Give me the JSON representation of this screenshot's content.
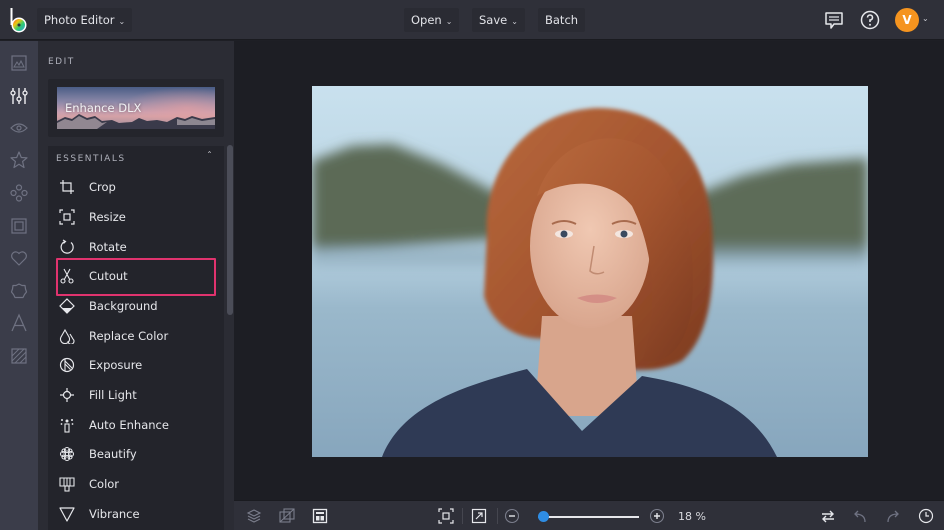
{
  "topbar": {
    "app_menu_label": "Photo Editor",
    "open_label": "Open",
    "save_label": "Save",
    "batch_label": "Batch",
    "icons": [
      "comment-icon",
      "help-icon"
    ],
    "avatar_initial": "V",
    "avatar_color": "#f5941f"
  },
  "rail": {
    "items": [
      {
        "icon": "image-icon",
        "active": false
      },
      {
        "icon": "sliders-icon",
        "active": true
      },
      {
        "icon": "eye-icon",
        "active": false
      },
      {
        "icon": "star-icon",
        "active": false
      },
      {
        "icon": "graphics-icon",
        "active": false
      },
      {
        "icon": "frame-icon",
        "active": false
      },
      {
        "icon": "heart-icon",
        "active": false
      },
      {
        "icon": "badge-icon",
        "active": false
      },
      {
        "icon": "text-icon",
        "active": false
      },
      {
        "icon": "texture-icon",
        "active": false
      }
    ]
  },
  "panel": {
    "section_label": "EDIT",
    "enhance_card_label": "Enhance DLX",
    "essentials": {
      "header": "ESSENTIALS",
      "collapse_glyph": "^",
      "tools": [
        {
          "label": "Crop",
          "icon": "crop-icon"
        },
        {
          "label": "Resize",
          "icon": "resize-icon"
        },
        {
          "label": "Rotate",
          "icon": "rotate-icon"
        },
        {
          "label": "Cutout",
          "icon": "scissors-icon",
          "highlighted": true
        },
        {
          "label": "Background",
          "icon": "background-icon"
        },
        {
          "label": "Replace Color",
          "icon": "droplets-icon"
        },
        {
          "label": "Exposure",
          "icon": "exposure-icon"
        },
        {
          "label": "Fill Light",
          "icon": "fill-light-icon"
        },
        {
          "label": "Auto Enhance",
          "icon": "auto-enhance-icon"
        },
        {
          "label": "Beautify",
          "icon": "beautify-icon"
        },
        {
          "label": "Color",
          "icon": "color-icon"
        },
        {
          "label": "Vibrance",
          "icon": "vibrance-icon"
        }
      ]
    },
    "highlight_color": "#e0336e"
  },
  "canvas": {
    "photo_description": "Portrait of red-haired woman in navy top with blurred lake and hills behind"
  },
  "bottombar": {
    "left_icons": [
      "layers-icon",
      "compare-icon",
      "layout-icon"
    ],
    "fit_icon": "fit-screen-icon",
    "expand_icon": "expand-icon",
    "zoom_out_icon": "zoom-out-icon",
    "zoom_in_icon": "zoom-in-icon",
    "zoom_percent": 18,
    "zoom_label": "18 %",
    "zoom_slider_fraction": 0.05,
    "accent_color": "#2f8de4",
    "right_icons": [
      "swap-icon",
      "undo-icon",
      "redo-icon",
      "history-icon"
    ]
  }
}
